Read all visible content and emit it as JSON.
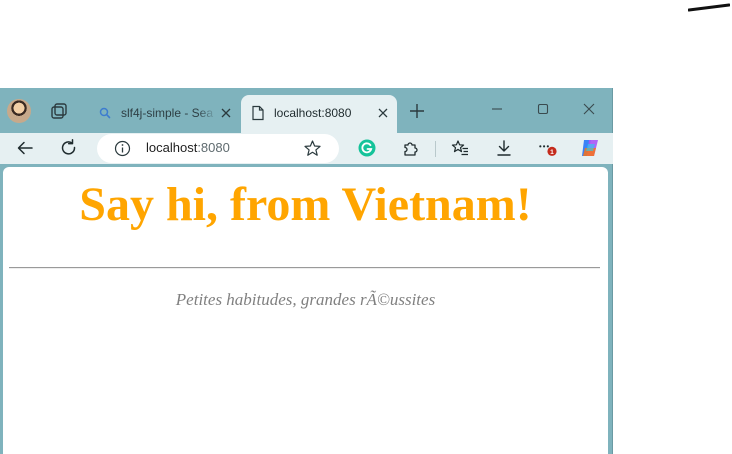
{
  "browser": {
    "tabs": [
      {
        "title": "slf4j-simple - Sea",
        "icon": "search-icon",
        "active": false
      },
      {
        "title": "localhost:8080",
        "icon": "page-icon",
        "active": true
      }
    ],
    "address": {
      "host": "localhost",
      "port": ":8080"
    },
    "notification_badge": "1"
  },
  "page": {
    "heading": "Say hi, from Vietnam!",
    "tagline": "Petites habitudes, grandes rÃ©ussites"
  },
  "colors": {
    "heading": "#ffa500",
    "tagline": "#808080",
    "frame": "#7fb3bd",
    "toolbar": "#e6f0f2",
    "badge": "#c42b1c"
  }
}
